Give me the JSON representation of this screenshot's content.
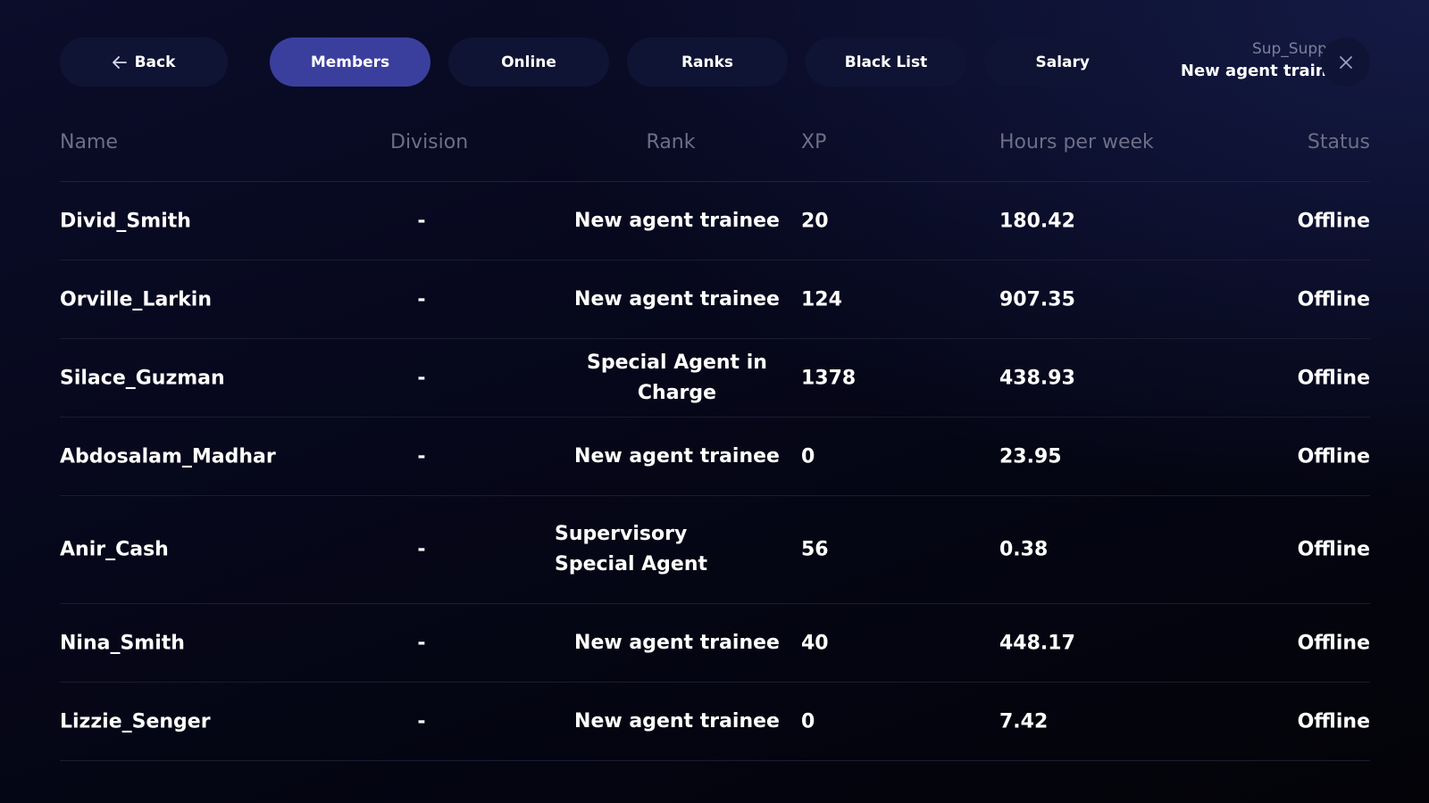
{
  "nav": {
    "back_label": "Back",
    "tabs": [
      {
        "label": "Members",
        "active": true
      },
      {
        "label": "Online",
        "active": false
      },
      {
        "label": "Ranks",
        "active": false
      },
      {
        "label": "Black List",
        "active": false
      },
      {
        "label": "Salary",
        "active": false
      }
    ]
  },
  "user": {
    "name": "Sup_Support",
    "rank": "New agent trainee"
  },
  "table": {
    "headers": {
      "name": "Name",
      "division": "Division",
      "rank": "Rank",
      "xp": "XP",
      "hours": "Hours per week",
      "status": "Status"
    },
    "rows": [
      {
        "name": "Divid_Smith",
        "division": "-",
        "rank": "New agent trainee",
        "xp": "20",
        "hours": "180.42",
        "status": "Offline"
      },
      {
        "name": "Orville_Larkin",
        "division": "-",
        "rank": "New agent trainee",
        "xp": "124",
        "hours": "907.35",
        "status": "Offline"
      },
      {
        "name": "Silace_Guzman",
        "division": "-",
        "rank": "Special Agent in Charge",
        "xp": "1378",
        "hours": "438.93",
        "status": "Offline"
      },
      {
        "name": "Abdosalam_Madhar",
        "division": "-",
        "rank": "New agent trainee",
        "xp": "0",
        "hours": "23.95",
        "status": "Offline"
      },
      {
        "name": "Anir_Cash",
        "division": "-",
        "rank": "Supervisory Special Agent",
        "xp": "56",
        "hours": "0.38",
        "status": "Offline"
      },
      {
        "name": "Nina_Smith",
        "division": "-",
        "rank": "New agent trainee",
        "xp": "40",
        "hours": "448.17",
        "status": "Offline"
      },
      {
        "name": "Lizzie_Senger",
        "division": "-",
        "rank": "New agent trainee",
        "xp": "0",
        "hours": "7.42",
        "status": "Offline"
      }
    ]
  },
  "colors": {
    "accent": "#3a3f9e",
    "pill_bg": "#0f1434",
    "header_text": "#6c6f86"
  },
  "icons": {
    "back": "arrow-left-icon",
    "close": "close-icon"
  }
}
